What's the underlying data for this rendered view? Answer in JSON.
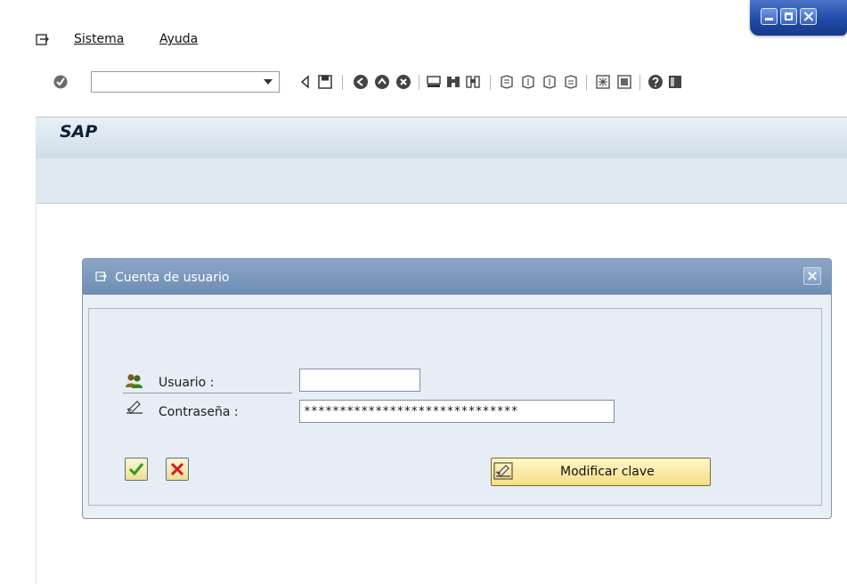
{
  "menu": {
    "items": [
      {
        "label": "Sistema"
      },
      {
        "label": "Ayuda"
      }
    ]
  },
  "toolbar": {
    "command_value": ""
  },
  "header": {
    "title": "SAP"
  },
  "dialog": {
    "title": "Cuenta de usuario",
    "user_label": "Usuario :",
    "user_value": "",
    "password_label": "Contraseña :",
    "password_value": "******************************",
    "change_password_label": "Modificar clave"
  },
  "colors": {
    "title_bar": "#1f4aa6",
    "dialog_title": "#7593b9",
    "accept_green": "#2a9d1e",
    "cancel_red": "#d11a1a"
  }
}
